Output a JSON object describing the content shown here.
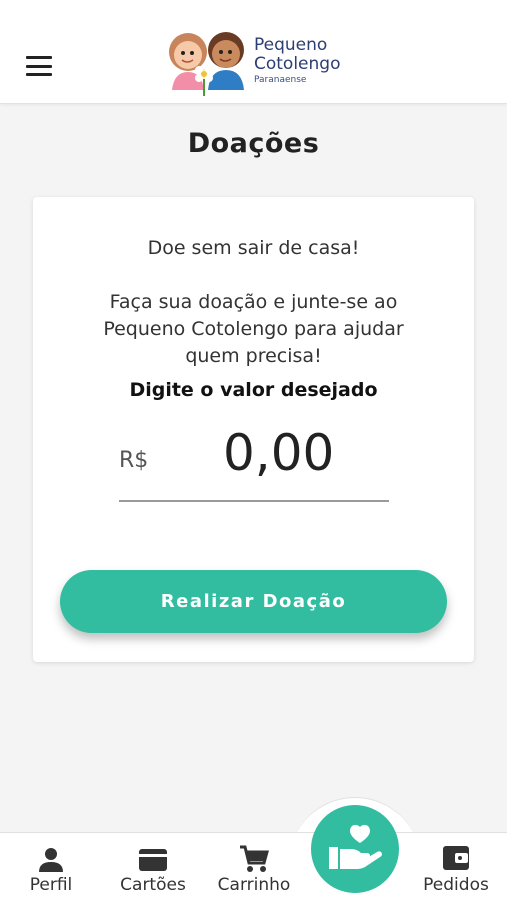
{
  "header": {
    "logo_line1": "Pequeno",
    "logo_line2": "Cotolengo",
    "logo_line3": "Paranaense",
    "menu_icon": "hamburger-menu-icon"
  },
  "page": {
    "title": "Doações"
  },
  "card": {
    "headline": "Doe sem sair de casa!",
    "paragraph": "Faça sua doação e junte-se ao Pequeno Cotolengo para ajudar quem precisa!",
    "prompt": "Digite o valor desejado",
    "currency": "R$",
    "amount_value": "0,00",
    "button_label": "Realizar Doação"
  },
  "bottom_nav": {
    "items": [
      {
        "label": "Perfil",
        "icon": "person-icon"
      },
      {
        "label": "Cartões",
        "icon": "credit-card-icon"
      },
      {
        "label": "Carrinho",
        "icon": "shopping-cart-icon"
      },
      {
        "label": "Pedidos",
        "icon": "wallet-icon"
      }
    ],
    "fab_icon": "donation-heart-hand-icon"
  },
  "colors": {
    "accent": "#32bda0",
    "logo_text": "#2c3e73",
    "background": "#f4f4f4"
  }
}
